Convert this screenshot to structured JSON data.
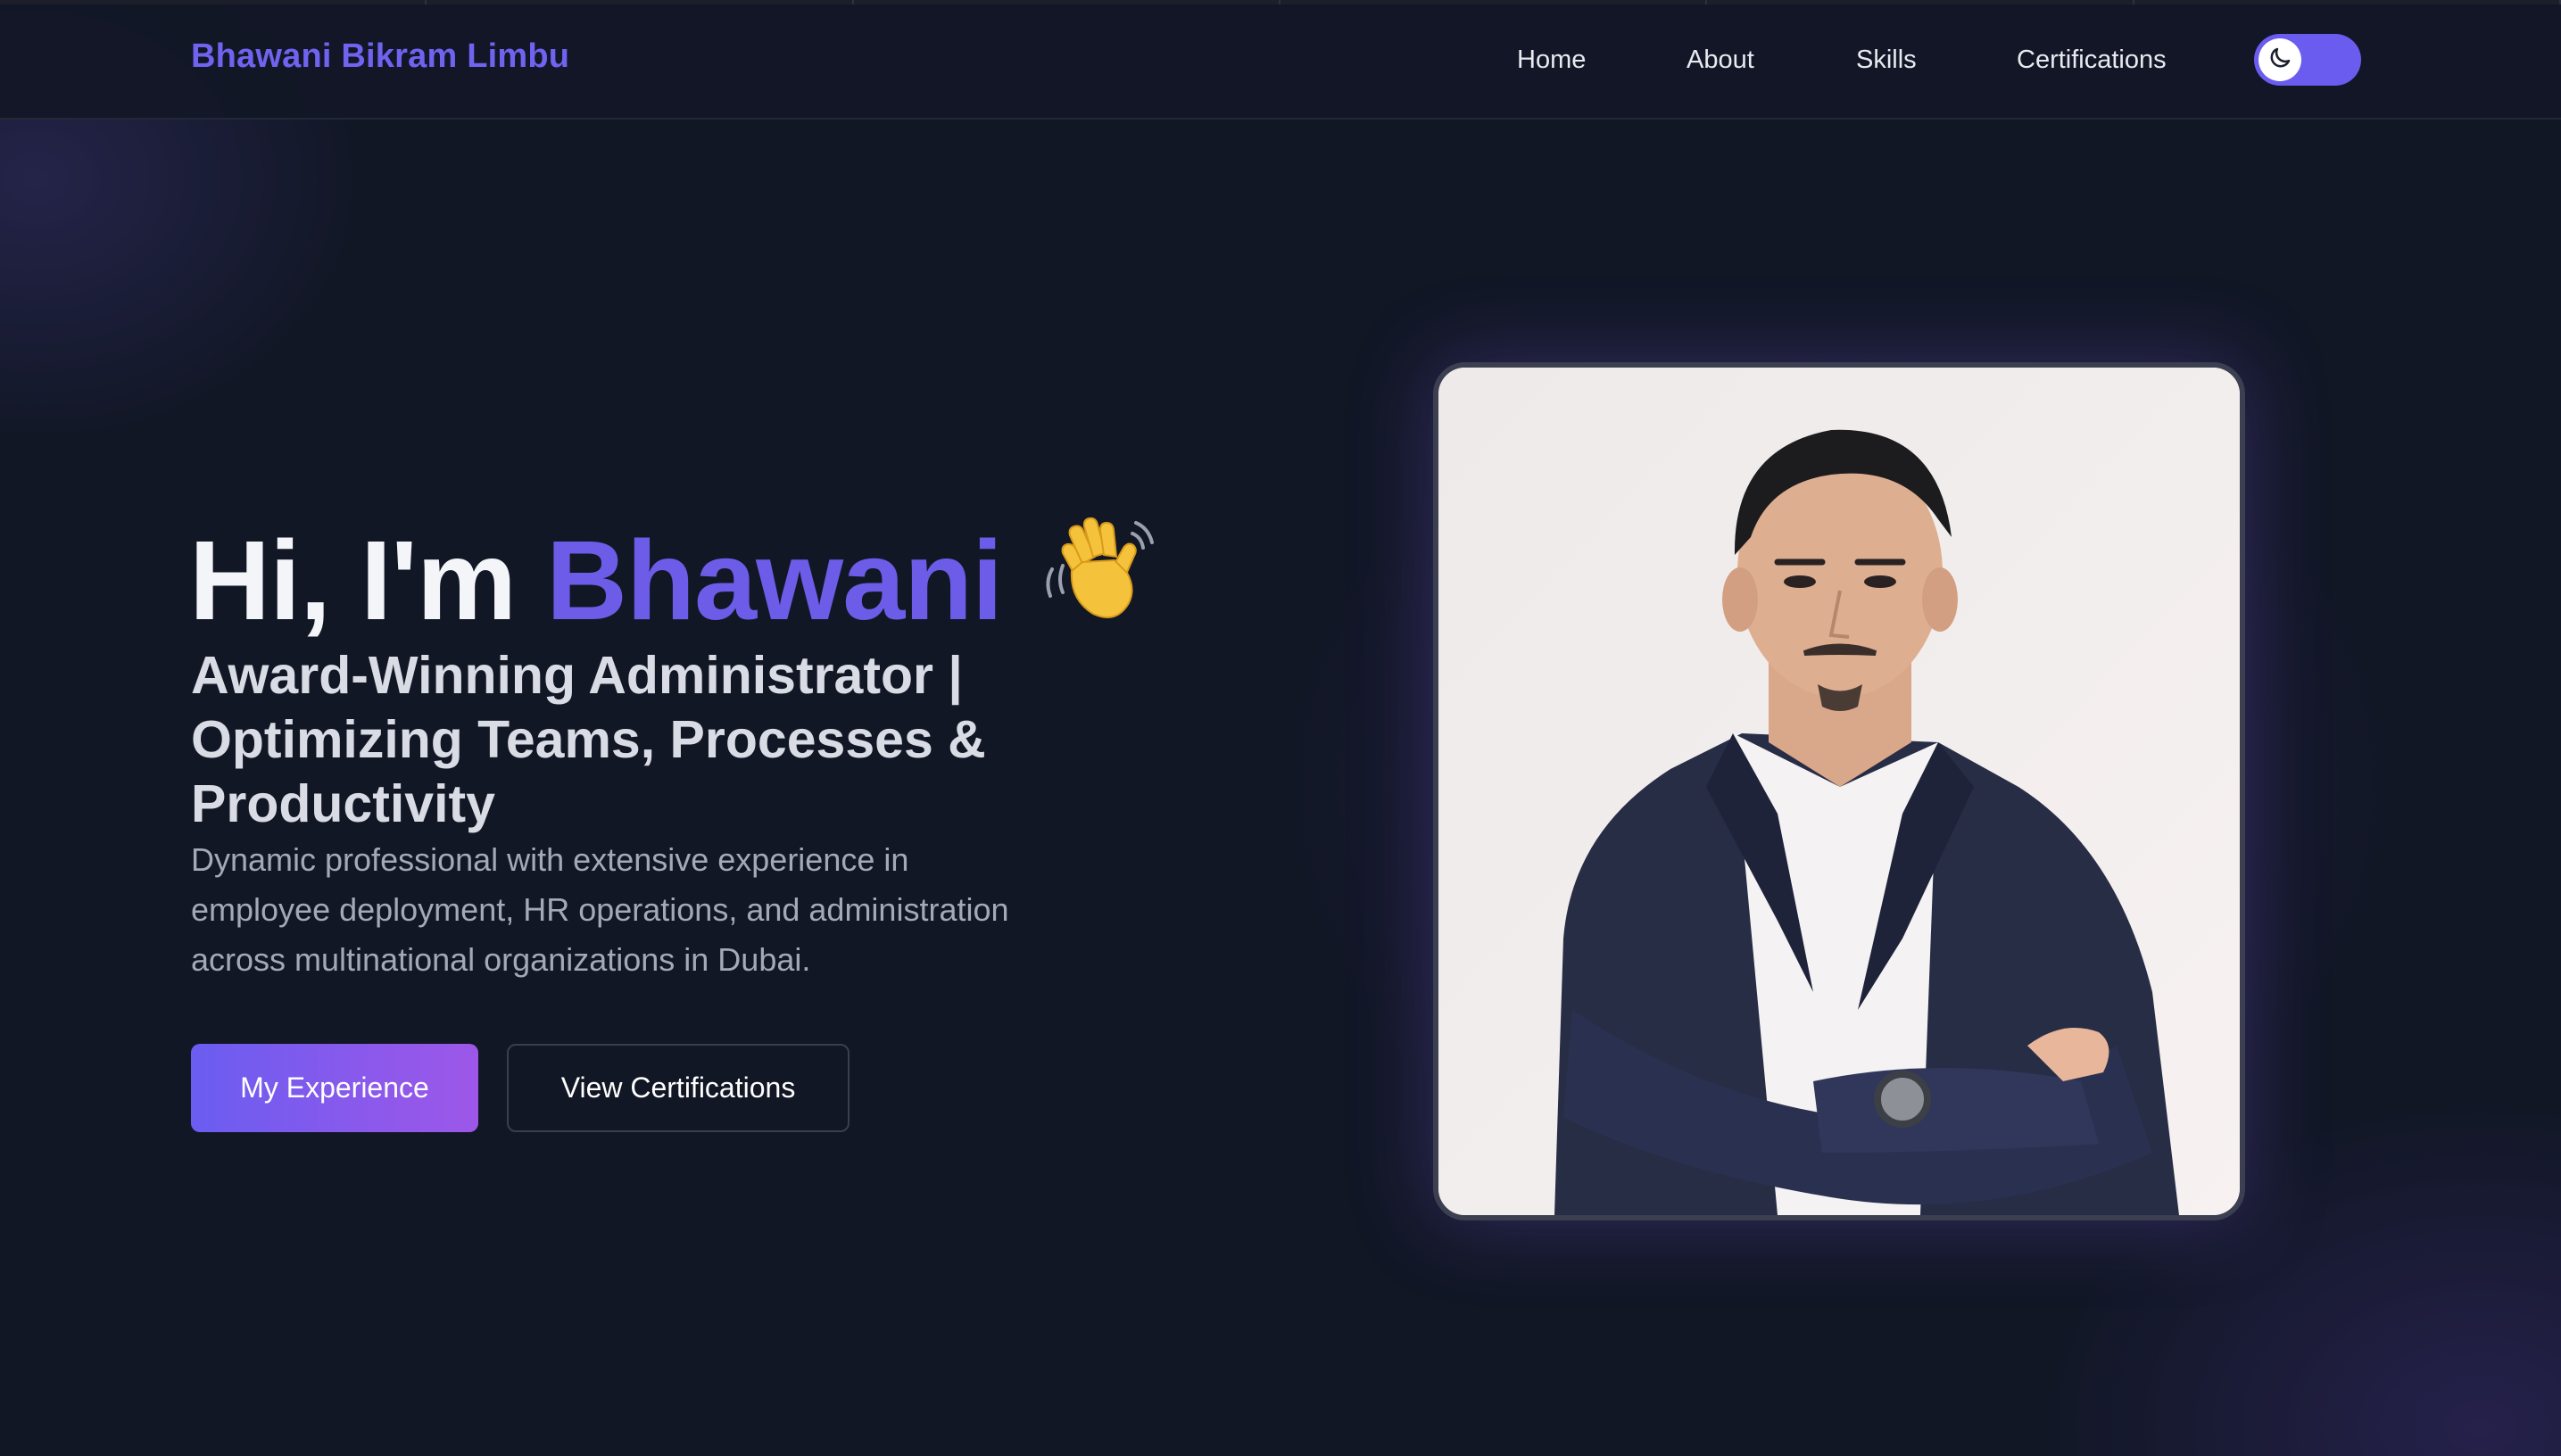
{
  "nav": {
    "brand": "Bhawani Bikram Limbu",
    "links": [
      "Home",
      "About",
      "Skills",
      "Certifications"
    ],
    "theme_toggle_icon": "moon-icon"
  },
  "hero": {
    "greeting": "Hi, I'm ",
    "name": "Bhawani",
    "wave_icon": "waving-hand-icon",
    "subtitle_lines": [
      "Award-Winning Administrator |",
      "Optimizing Teams, Processes &",
      "Productivity"
    ],
    "description_lines": [
      "Dynamic professional with extensive experience in",
      "employee deployment, HR operations, and administration",
      "across multinational organizations in Dubai."
    ],
    "primary_button": "My Experience",
    "secondary_button": "View Certifications"
  },
  "colors": {
    "background": "#121726",
    "accent": "#6c5ce7",
    "button_gradient_end": "#9d57e8"
  }
}
